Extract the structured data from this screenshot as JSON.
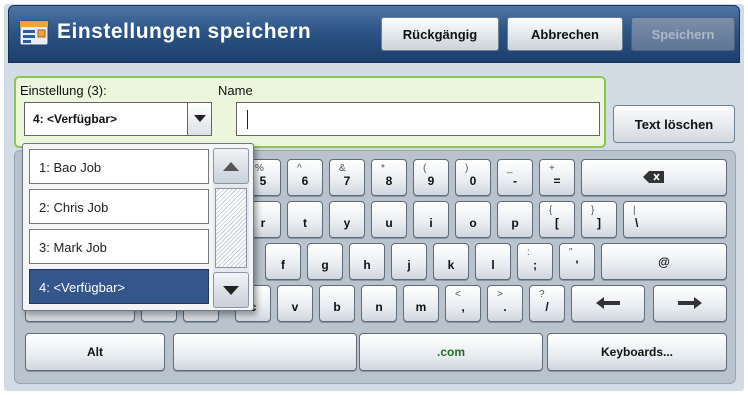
{
  "header": {
    "title": "Einstellungen speichern",
    "icon": "save-settings-icon",
    "buttons": {
      "undo": "Rückgängig",
      "cancel": "Abbrechen",
      "save": "Speichern"
    }
  },
  "form": {
    "setting_label": "Einstellung (3):",
    "setting_value": "4: <Verfügbar>",
    "name_label": "Name",
    "name_value": "",
    "clear_text": "Text löschen"
  },
  "dropdown": {
    "items": [
      "1: Bao Job",
      "2: Chris Job",
      "3: Mark Job",
      "4: <Verfügbar>"
    ],
    "selected_index": 3
  },
  "keyboard": {
    "row1": [
      {
        "sub": "%",
        "main": "5"
      },
      {
        "sub": "^",
        "main": "6"
      },
      {
        "sub": "&",
        "main": "7"
      },
      {
        "sub": "*",
        "main": "8"
      },
      {
        "sub": "(",
        "main": "9"
      },
      {
        "sub": ")",
        "main": "0"
      },
      {
        "sub": "_",
        "main": "-"
      },
      {
        "sub": "+",
        "main": "="
      }
    ],
    "row2": [
      {
        "sub": "",
        "main": "r"
      },
      {
        "sub": "",
        "main": "t"
      },
      {
        "sub": "",
        "main": "y"
      },
      {
        "sub": "",
        "main": "u"
      },
      {
        "sub": "",
        "main": "i"
      },
      {
        "sub": "",
        "main": "o"
      },
      {
        "sub": "",
        "main": "p"
      },
      {
        "sub": "{",
        "main": "["
      },
      {
        "sub": "}",
        "main": "]"
      },
      {
        "sub": "|",
        "main": "\\"
      }
    ],
    "row3": [
      {
        "sub": "",
        "main": "f"
      },
      {
        "sub": "",
        "main": "g"
      },
      {
        "sub": "",
        "main": "h"
      },
      {
        "sub": "",
        "main": "j"
      },
      {
        "sub": "",
        "main": "k"
      },
      {
        "sub": "",
        "main": "l"
      },
      {
        "sub": ":",
        "main": ";"
      },
      {
        "sub": "\"",
        "main": "'"
      },
      {
        "sub": "",
        "main": "@"
      }
    ],
    "row4": [
      {
        "sub": "",
        "main": "c"
      },
      {
        "sub": "",
        "main": "v"
      },
      {
        "sub": "",
        "main": "b"
      },
      {
        "sub": "",
        "main": "n"
      },
      {
        "sub": "",
        "main": "m"
      },
      {
        "sub": "<",
        "main": ","
      },
      {
        "sub": ">",
        "main": "."
      },
      {
        "sub": "?",
        "main": "/"
      }
    ],
    "bottom": {
      "alt": "Alt",
      "com": ".com",
      "keyboards": "Keyboards..."
    }
  },
  "colors": {
    "title_bar": "#2c5486",
    "selection": "#34568c",
    "green_border": "#8ac555",
    "green_fill": "#ebf6dc"
  }
}
